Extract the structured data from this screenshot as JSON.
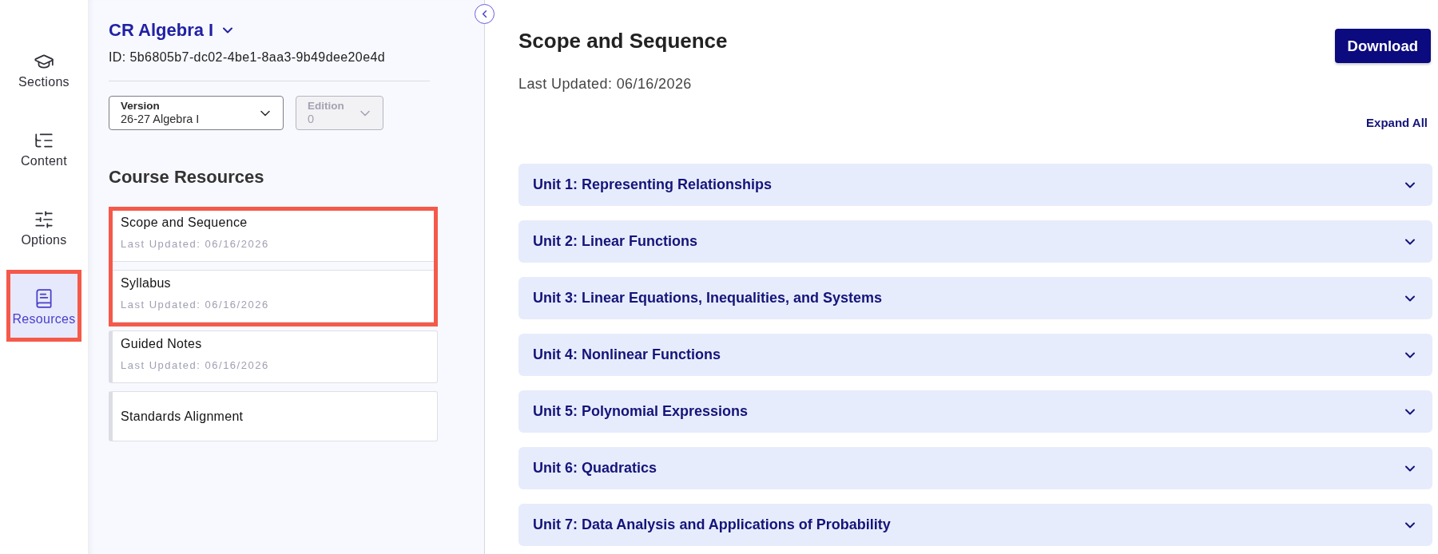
{
  "nav": [
    {
      "label": "Sections",
      "selected": false,
      "highlighted": false
    },
    {
      "label": "Content",
      "selected": false,
      "highlighted": false
    },
    {
      "label": "Options",
      "selected": false,
      "highlighted": false
    },
    {
      "label": "Resources",
      "selected": true,
      "highlighted": true
    }
  ],
  "course": {
    "title": "CR Algebra I",
    "id_text": "ID: 5b6805b7-dc02-4be1-8aa3-9b49dee20e4d"
  },
  "selects": [
    {
      "label": "Version",
      "value": "26-27 Algebra I",
      "disabled": false
    },
    {
      "label": "Edition",
      "value": "0",
      "disabled": true
    }
  ],
  "resources": {
    "heading": "Course Resources",
    "items": [
      {
        "title": "Scope and Sequence",
        "updated": "Last Updated: 06/16/2026",
        "highlighted": true
      },
      {
        "title": "Syllabus",
        "updated": "Last Updated: 06/16/2026",
        "highlighted": true
      },
      {
        "title": "Guided Notes",
        "updated": "Last Updated: 06/16/2026",
        "highlighted": false
      },
      {
        "title": "Standards Alignment",
        "highlighted": false
      }
    ]
  },
  "document": {
    "title": "Scope and Sequence",
    "updated": "Last Updated: 06/16/2026",
    "download": "Download",
    "expand_all": "Expand All",
    "units": [
      {
        "label": "Unit 1: Representing Relationships",
        "expanded": false
      },
      {
        "label": "Unit 2: Linear Functions",
        "expanded": false
      },
      {
        "label": "Unit 3: Linear Equations, Inequalities, and Systems",
        "expanded": false
      },
      {
        "label": "Unit 4: Nonlinear Functions",
        "expanded": false
      },
      {
        "label": "Unit 5: Polynomial Expressions",
        "expanded": false
      },
      {
        "label": "Unit 6: Quadratics",
        "expanded": false
      },
      {
        "label": "Unit 7: Data Analysis and Applications of Probability",
        "expanded": false
      }
    ]
  }
}
